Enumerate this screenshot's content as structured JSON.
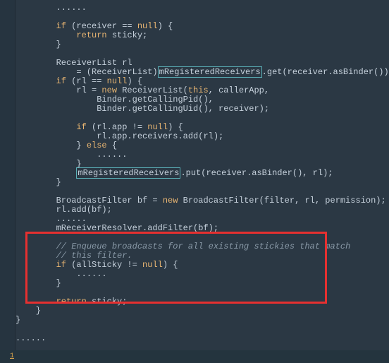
{
  "code_lines": [
    "        ......",
    "",
    "        if (receiver == null) {",
    "            return sticky;",
    "        }",
    "",
    "        ReceiverList rl",
    "            = (ReceiverList)mRegisteredReceivers.get(receiver.asBinder());",
    "        if (rl == null) {",
    "            rl = new ReceiverList(this, callerApp,",
    "                Binder.getCallingPid(),",
    "                Binder.getCallingUid(), receiver);",
    "",
    "            if (rl.app != null) {",
    "                rl.app.receivers.add(rl);",
    "            } else {",
    "                ......",
    "            }",
    "            mRegisteredReceivers.put(receiver.asBinder(), rl);",
    "        }",
    "",
    "        BroadcastFilter bf = new BroadcastFilter(filter, rl, permission);",
    "        rl.add(bf);",
    "        ......",
    "        mReceiverResolver.addFilter(bf);",
    "",
    "        // Enqueue broadcasts for all existing stickies that match",
    "        // this filter.",
    "        if (allSticky != null) {",
    "            ......",
    "        }",
    "",
    "        return sticky;",
    "    }",
    "}",
    "",
    "......"
  ],
  "bottom_icon": "1"
}
